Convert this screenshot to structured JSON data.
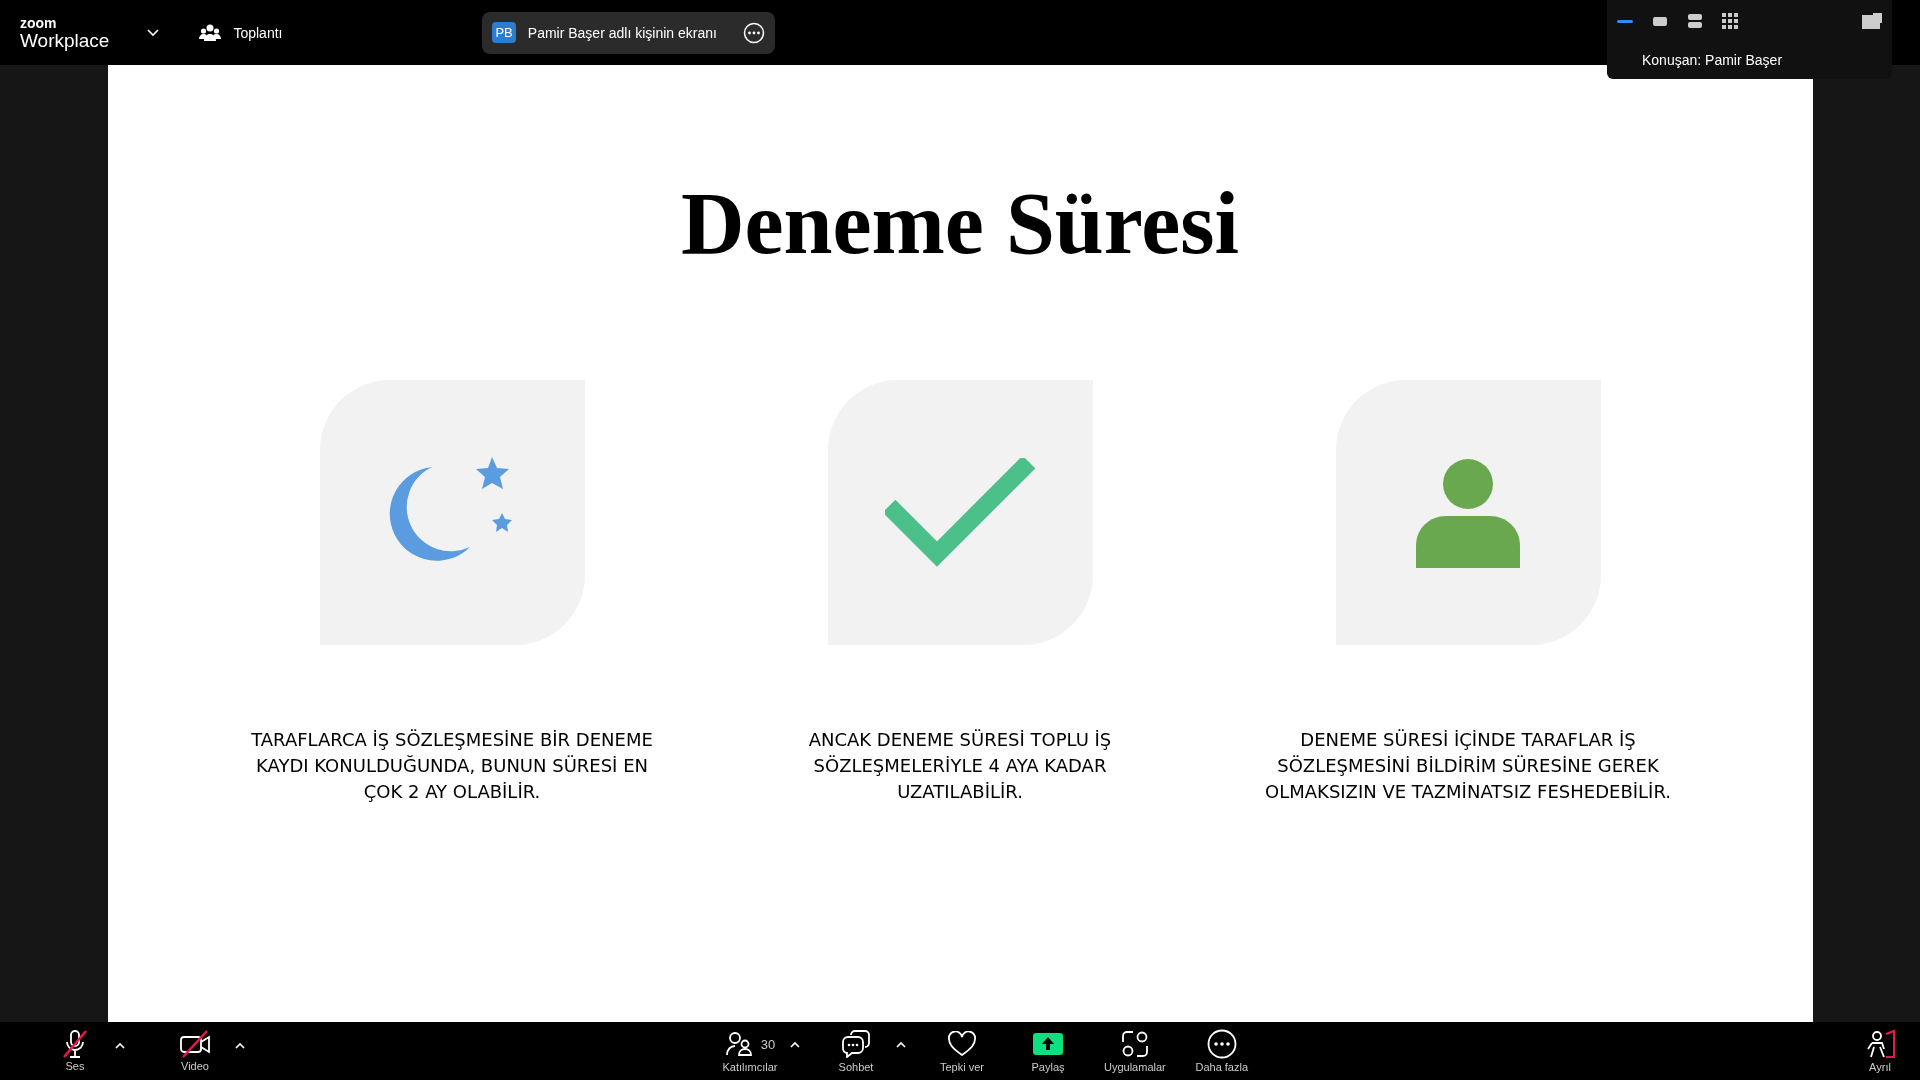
{
  "app": {
    "brand_small": "zoom",
    "brand": "Workplace"
  },
  "meeting": {
    "label": "Toplantı"
  },
  "share_pill": {
    "initials": "PB",
    "label": "Pamir Başer adlı kişinin ekranı"
  },
  "view_popup": {
    "layouts": [
      {
        "kind": "speaker",
        "selected": true
      },
      {
        "kind": "single",
        "selected": false
      },
      {
        "kind": "stacked",
        "selected": false
      },
      {
        "kind": "gallery",
        "selected": false
      }
    ],
    "speaker": "Konuşan: Pamir Başer"
  },
  "slide": {
    "title": "Deneme Süresi",
    "cards": [
      {
        "kind": "moon",
        "text": "TARAFLARCA İŞ SÖZLEŞMESİNE BİR DENEME KAYDI KONULDUĞUNDA, BUNUN SÜRESİ EN ÇOK 2 AY OLABİLİR."
      },
      {
        "kind": "check",
        "text": "ANCAK DENEME SÜRESİ TOPLU İŞ SÖZLEŞMELERİYLE 4 AYA KADAR UZATILABİLİR."
      },
      {
        "kind": "person",
        "text": "DENEME SÜRESİ İÇİNDE TARAFLAR İŞ SÖZLEŞMESİNİ BİLDİRİM SÜRESİNE GEREK OLMAKSIZIN VE TAZMİNATSIZ FESHEDEBİLİR."
      }
    ]
  },
  "toolbar": {
    "left": [
      {
        "kind": "mic",
        "label": "Ses",
        "muted": true
      },
      {
        "kind": "video",
        "label": "Video",
        "muted": true
      }
    ],
    "center": [
      {
        "kind": "participants",
        "label": "Katılımcılar",
        "count": "30",
        "caret": true
      },
      {
        "kind": "chat",
        "label": "Sohbet",
        "caret": true
      },
      {
        "kind": "react",
        "label": "Tepki ver",
        "caret": false
      },
      {
        "kind": "share",
        "label": "Paylaş",
        "caret": false
      },
      {
        "kind": "apps",
        "label": "Uygulamalar",
        "caret": false
      },
      {
        "kind": "more",
        "label": "Daha fazla",
        "caret": false
      }
    ],
    "leave": {
      "label": "Ayrıl"
    }
  }
}
